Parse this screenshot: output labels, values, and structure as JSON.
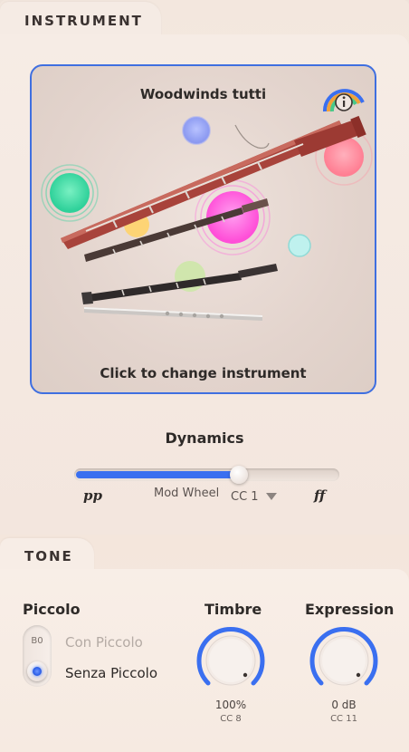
{
  "instrument_section": {
    "tab_label": "INSTRUMENT",
    "name": "Woodwinds tutti",
    "cta": "Click to change instrument"
  },
  "dynamics": {
    "title": "Dynamics",
    "min_label": "pp",
    "max_label": "ff",
    "source_label": "Mod Wheel",
    "cc_label": "CC 1",
    "value": 0.63,
    "fill_color": "#3a6ff0"
  },
  "tone_section": {
    "tab_label": "TONE",
    "piccolo": {
      "title": "Piccolo",
      "key_label": "B0",
      "options": [
        "Con Piccolo",
        "Senza Piccolo"
      ],
      "selected_index": 1
    },
    "timbre": {
      "title": "Timbre",
      "value": "100%",
      "cc": "CC 8",
      "level": 1.0
    },
    "expression": {
      "title": "Expression",
      "value": "0 dB",
      "cc": "CC 11",
      "level": 1.0
    }
  },
  "colors": {
    "accent": "#3f6fe0"
  },
  "icons": {
    "info": "info-icon"
  }
}
